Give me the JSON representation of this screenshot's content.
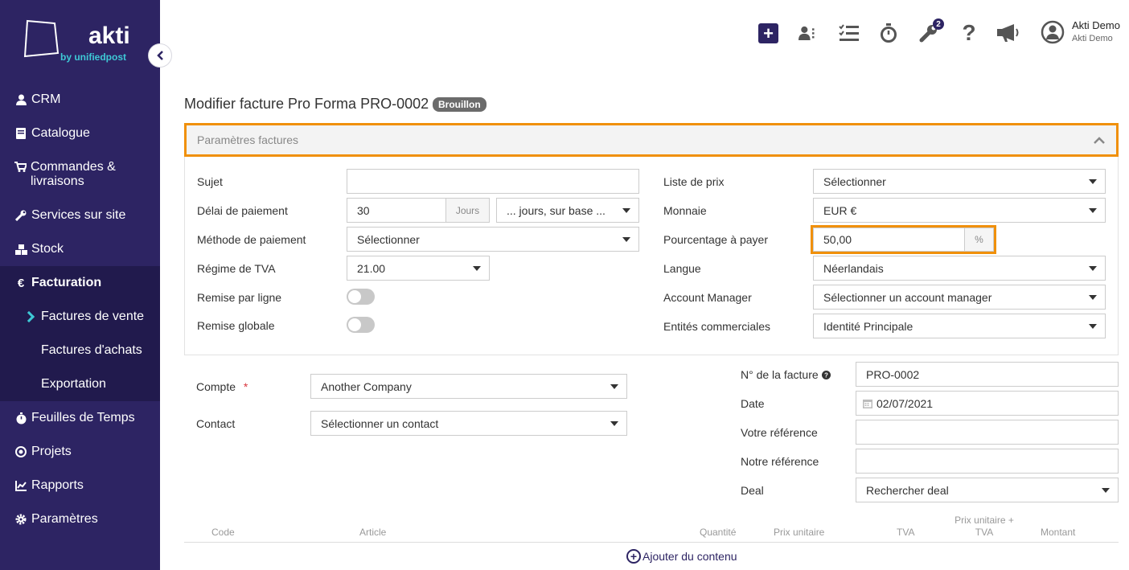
{
  "brand": {
    "name": "akti",
    "tagline": "by unifiedpost"
  },
  "sidebar": {
    "items": [
      {
        "label": "CRM",
        "icon": "user-icon"
      },
      {
        "label": "Catalogue",
        "icon": "book-icon"
      },
      {
        "label": "Commandes & livraisons",
        "icon": "cart-icon"
      },
      {
        "label": "Services sur site",
        "icon": "wrench-icon"
      },
      {
        "label": "Stock",
        "icon": "boxes-icon"
      },
      {
        "label": "Facturation",
        "icon": "euro-icon"
      },
      {
        "label": "Feuilles de Temps",
        "icon": "stopwatch-icon"
      },
      {
        "label": "Projets",
        "icon": "target-icon"
      },
      {
        "label": "Rapports",
        "icon": "chart-icon"
      },
      {
        "label": "Paramètres",
        "icon": "gear-icon"
      }
    ],
    "submenu": [
      {
        "label": "Factures de vente"
      },
      {
        "label": "Factures d'achats"
      },
      {
        "label": "Exportation"
      }
    ]
  },
  "topbar": {
    "notification_count": "2",
    "user_name": "Akti Demo",
    "user_company": "Akti Demo"
  },
  "page": {
    "title": "Modifier facture Pro Forma PRO-0002",
    "status": "Brouillon"
  },
  "params": {
    "header": "Paramètres factures",
    "left": {
      "subject_label": "Sujet",
      "subject_value": "",
      "payment_delay_label": "Délai de paiement",
      "payment_delay_value": "30",
      "payment_delay_unit": "Jours",
      "payment_delay_basis": "... jours, sur base ...",
      "payment_method_label": "Méthode de paiement",
      "payment_method_value": "Sélectionner",
      "vat_regime_label": "Régime de TVA",
      "vat_regime_value": "21.00",
      "line_discount_label": "Remise par ligne",
      "global_discount_label": "Remise globale"
    },
    "right": {
      "price_list_label": "Liste de prix",
      "price_list_value": "Sélectionner",
      "currency_label": "Monnaie",
      "currency_value": "EUR €",
      "percent_label": "Pourcentage à payer",
      "percent_value": "50,00",
      "percent_unit": "%",
      "language_label": "Langue",
      "language_value": "Néerlandais",
      "account_manager_label": "Account Manager",
      "account_manager_value": "Sélectionner un account manager",
      "entities_label": "Entités commerciales",
      "entities_value": "Identité Principale"
    }
  },
  "invoice": {
    "account_label": "Compte",
    "required_mark": "*",
    "account_value": "Another Company",
    "contact_label": "Contact",
    "contact_value": "Sélectionner un contact",
    "number_label": "N° de la facture",
    "number_value": "PRO-0002",
    "date_label": "Date",
    "date_value": "02/07/2021",
    "your_ref_label": "Votre référence",
    "your_ref_value": "",
    "our_ref_label": "Notre référence",
    "our_ref_value": "",
    "deal_label": "Deal",
    "deal_value": "Rechercher deal"
  },
  "table": {
    "columns": [
      "Code",
      "Article",
      "Quantité",
      "Prix unitaire",
      "TVA",
      "Prix unitaire + TVA",
      "Montant"
    ],
    "add_content": "Ajouter du contenu"
  }
}
